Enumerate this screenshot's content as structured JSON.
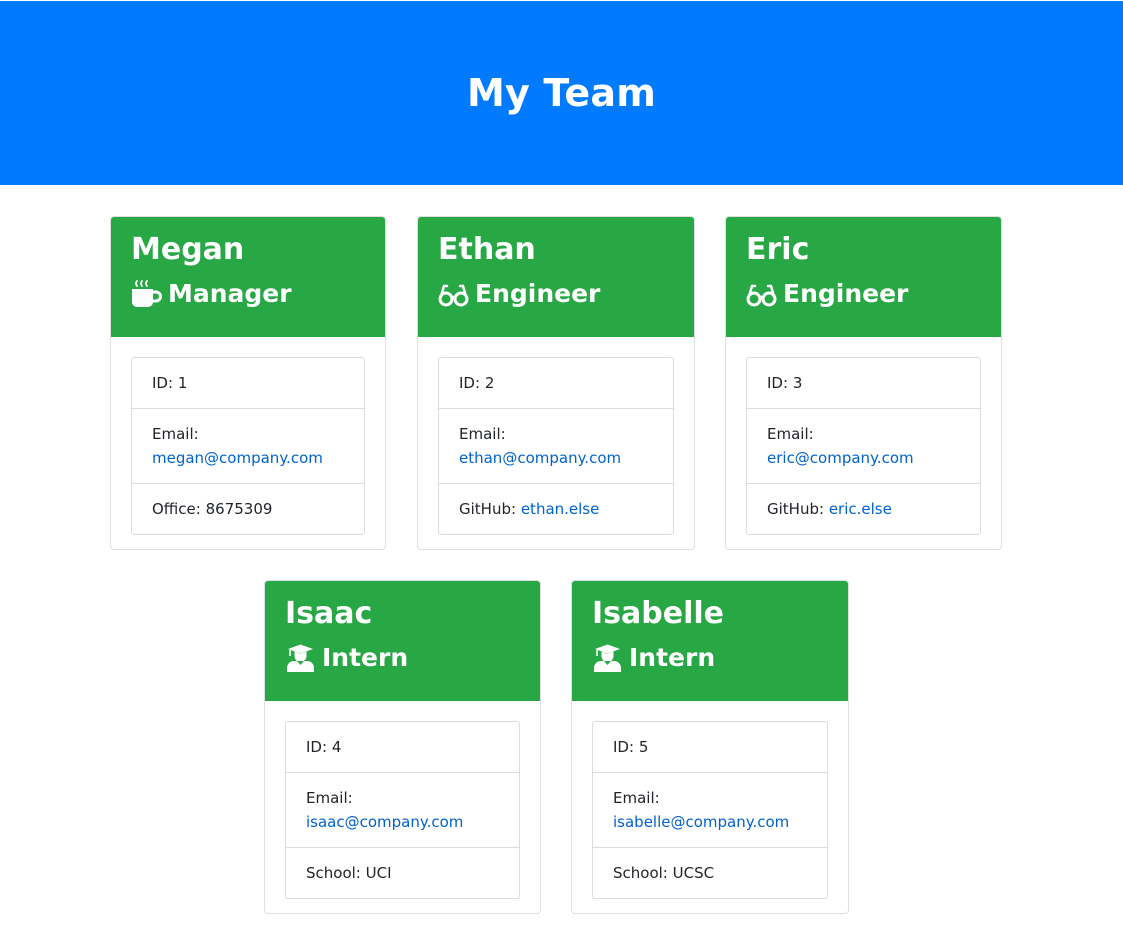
{
  "header": {
    "title": "My Team"
  },
  "team": [
    {
      "name": "Megan",
      "role": "Manager",
      "icon": "coffee-icon",
      "id_label": "ID:",
      "id": "1",
      "email_label": "Email:",
      "email": "megan@company.com",
      "extra_label": "Office:",
      "extra_value": "8675309"
    },
    {
      "name": "Ethan",
      "role": "Engineer",
      "icon": "glasses-icon",
      "id_label": "ID:",
      "id": "2",
      "email_label": "Email:",
      "email": "ethan@company.com",
      "extra_label": "GitHub:",
      "extra_value": "ethan.else"
    },
    {
      "name": "Eric",
      "role": "Engineer",
      "icon": "glasses-icon",
      "id_label": "ID:",
      "id": "3",
      "email_label": "Email:",
      "email": "eric@company.com",
      "extra_label": "GitHub:",
      "extra_value": "eric.else"
    },
    {
      "name": "Isaac",
      "role": "Intern",
      "icon": "graduate-icon",
      "id_label": "ID:",
      "id": "4",
      "email_label": "Email:",
      "email": "isaac@company.com",
      "extra_label": "School:",
      "extra_value": "UCI"
    },
    {
      "name": "Isabelle",
      "role": "Intern",
      "icon": "graduate-icon",
      "id_label": "ID:",
      "id": "5",
      "email_label": "Email:",
      "email": "isabelle@company.com",
      "extra_label": "School:",
      "extra_value": "UCSC"
    }
  ],
  "colors": {
    "header_bg": "#007bff",
    "card_header_bg": "#28a745",
    "link": "#0062cc"
  }
}
